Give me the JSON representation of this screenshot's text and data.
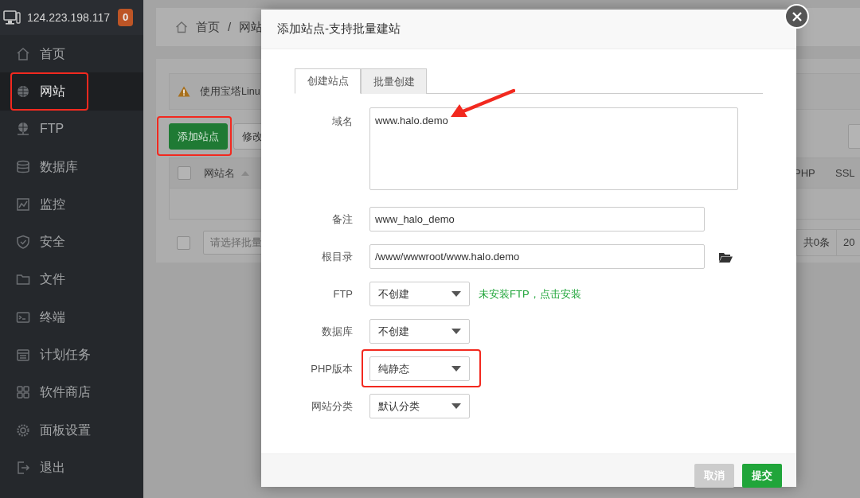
{
  "server": {
    "ip": "124.223.198.117",
    "notifications": "0"
  },
  "sidebar": {
    "items": [
      {
        "label": "首页",
        "selected": false,
        "highlighted": false
      },
      {
        "label": "网站",
        "selected": true,
        "highlighted": true
      },
      {
        "label": "FTP",
        "selected": false,
        "highlighted": false
      },
      {
        "label": "数据库",
        "selected": false,
        "highlighted": false
      },
      {
        "label": "监控",
        "selected": false,
        "highlighted": false
      },
      {
        "label": "安全",
        "selected": false,
        "highlighted": false
      },
      {
        "label": "文件",
        "selected": false,
        "highlighted": false
      },
      {
        "label": "终端",
        "selected": false,
        "highlighted": false
      },
      {
        "label": "计划任务",
        "selected": false,
        "highlighted": false
      },
      {
        "label": "软件商店",
        "selected": false,
        "highlighted": false
      },
      {
        "label": "面板设置",
        "selected": false,
        "highlighted": false
      },
      {
        "label": "退出",
        "selected": false,
        "highlighted": false
      }
    ]
  },
  "breadcrumb": {
    "items": [
      "首页",
      "网站"
    ],
    "separator": "/"
  },
  "alert": {
    "text": "使用宝塔Linu"
  },
  "toolbar": {
    "buttons": [
      {
        "label": "添加站点",
        "kind": "primary",
        "highlighted": true
      },
      {
        "label": "修改",
        "kind": "default",
        "highlighted": false
      }
    ]
  },
  "table": {
    "columns": [
      {
        "label": "网站名",
        "sorted": true
      },
      {
        "label": "PHP",
        "sorted": false
      },
      {
        "label": "SSL",
        "sorted": false
      }
    ],
    "select_all_checked": false,
    "footer_checked": false,
    "batch_placeholder": "请选择批量",
    "total": "共0条",
    "page_size": "20"
  },
  "modal": {
    "title": "添加站点-支持批量建站",
    "tabs": [
      {
        "label": "创建站点",
        "selected": true
      },
      {
        "label": "批量创建",
        "selected": false
      }
    ],
    "fields": [
      {
        "label": "域名",
        "kind": "textarea",
        "value": "www.halo.demo",
        "highlighted": false,
        "pointed": true
      },
      {
        "label": "备注",
        "kind": "text",
        "value": "www_halo_demo",
        "highlighted": false,
        "pointed": false
      },
      {
        "label": "根目录",
        "kind": "path",
        "value": "/www/wwwroot/www.halo.demo",
        "highlighted": false,
        "pointed": false
      },
      {
        "label": "FTP",
        "kind": "select",
        "value": "不创建",
        "hint": "未安装FTP，点击安装",
        "highlighted": false,
        "pointed": false
      },
      {
        "label": "数据库",
        "kind": "select",
        "value": "不创建",
        "highlighted": false,
        "pointed": false
      },
      {
        "label": "PHP版本",
        "kind": "select",
        "value": "纯静态",
        "highlighted": true,
        "pointed": false
      },
      {
        "label": "网站分类",
        "kind": "select",
        "value": "默认分类",
        "highlighted": false,
        "pointed": false
      }
    ],
    "buttons": [
      {
        "label": "取消",
        "kind": "cancel"
      },
      {
        "label": "提交",
        "kind": "submit"
      }
    ]
  }
}
